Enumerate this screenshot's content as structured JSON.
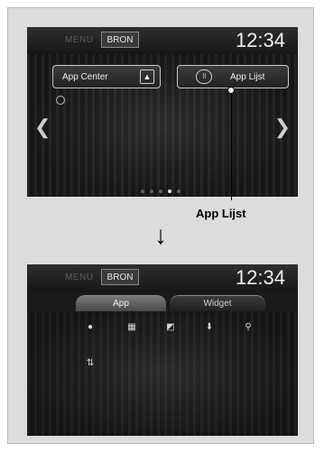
{
  "top_screen": {
    "status": {
      "menu_label": "MENU",
      "bron_label": "BRON",
      "time": "12:34"
    },
    "buttons": {
      "app_center_label": "App Center",
      "app_lijst_label": "App Lijst"
    },
    "icons": {
      "app_center_icon": "app-center-icon",
      "app_lijst_icon": "grid-dots-icon",
      "gauge_icon": "gauge-icon",
      "left_arrow": "chevron-left-icon",
      "right_arrow": "chevron-right-icon"
    },
    "pagination": {
      "count": 5,
      "active_index": 3
    }
  },
  "annotation": {
    "callout_label": "App Lijst",
    "arrow_icon": "down-arrow-icon"
  },
  "bottom_screen": {
    "status": {
      "menu_label": "MENU",
      "bron_label": "BRON",
      "time": "12:34"
    },
    "tabs": [
      {
        "label": "App",
        "active": true
      },
      {
        "label": "Widget",
        "active": false
      }
    ],
    "app_icons": [
      "globe-icon",
      "grid-icon",
      "image-icon",
      "download-icon",
      "search-icon",
      "settings-shortcut-icon"
    ]
  },
  "colors": {
    "panel_bg": "#dcdcdc",
    "screen_bg": "#1a1a1a",
    "accent_white": "#f2f2f2"
  }
}
